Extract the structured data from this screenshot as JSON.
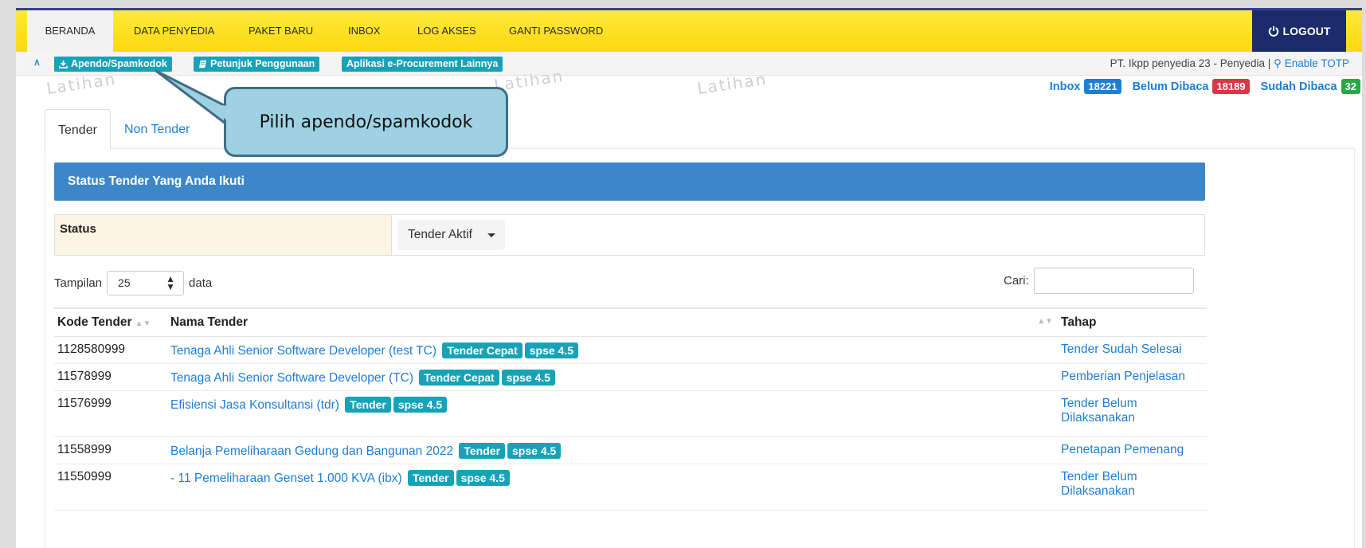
{
  "nav": {
    "items": [
      "BERANDA",
      "DATA PENYEDIA",
      "PAKET BARU",
      "INBOX",
      "LOG AKSES",
      "GANTI PASSWORD"
    ],
    "logout": "LOGOUT"
  },
  "subbar": {
    "buttons": [
      "Apendo/Spamkodok",
      "Petunjuk Penggunaan",
      "Aplikasi e-Procurement Lainnya"
    ],
    "user": "PT. Ikpp penyedia 23 - Penyedia |",
    "totp": "Enable TOTP"
  },
  "watermark": "Latihan",
  "counters": {
    "inbox_label": "Inbox",
    "inbox_count": "18221",
    "unread_label": "Belum Dibaca",
    "unread_count": "18189",
    "read_label": "Sudah Dibaca",
    "read_count": "32"
  },
  "tabs": [
    "Tender",
    "Non Tender"
  ],
  "callout": "Pilih apendo/spamkodok",
  "section_title": "Status Tender Yang Anda Ikuti",
  "status": {
    "label": "Status",
    "value": "Tender Aktif"
  },
  "length": {
    "prefix": "Tampilan",
    "value": "25",
    "suffix": "data"
  },
  "search_label": "Cari:",
  "table": {
    "headers": [
      "Kode Tender",
      "Nama Tender",
      "Tahap"
    ],
    "rows": [
      {
        "kode": "1128580999",
        "nama": "Tenaga Ahli Senior Software Developer (test TC)",
        "badges": [
          "Tender Cepat",
          "spse 4.5"
        ],
        "tahap": "Tender Sudah Selesai"
      },
      {
        "kode": "11578999",
        "nama": "Tenaga Ahli Senior Software Developer (TC)",
        "badges": [
          "Tender Cepat",
          "spse 4.5"
        ],
        "tahap": "Pemberian Penjelasan"
      },
      {
        "kode": "11576999",
        "nama": "Efisiensi Jasa Konsultansi (tdr)",
        "badges": [
          "Tender",
          "spse 4.5"
        ],
        "tahap": "Tender Belum Dilaksanakan"
      },
      {
        "kode": "11558999",
        "nama": "Belanja Pemeliharaan Gedung dan Bangunan 2022",
        "badges": [
          "Tender",
          "spse 4.5"
        ],
        "tahap": "Penetapan Pemenang"
      },
      {
        "kode": "11550999",
        "nama": "- 11 Pemeliharaan Genset 1.000 KVA (ibx)",
        "badges": [
          "Tender",
          "spse 4.5"
        ],
        "tahap": "Tender Belum Dilaksanakan"
      }
    ]
  },
  "colors": {
    "nav": "#ffe21f",
    "logout": "#1b2b6b",
    "accent": "#17a2b8",
    "header": "#3d87c9",
    "link": "#1e7ed6"
  }
}
